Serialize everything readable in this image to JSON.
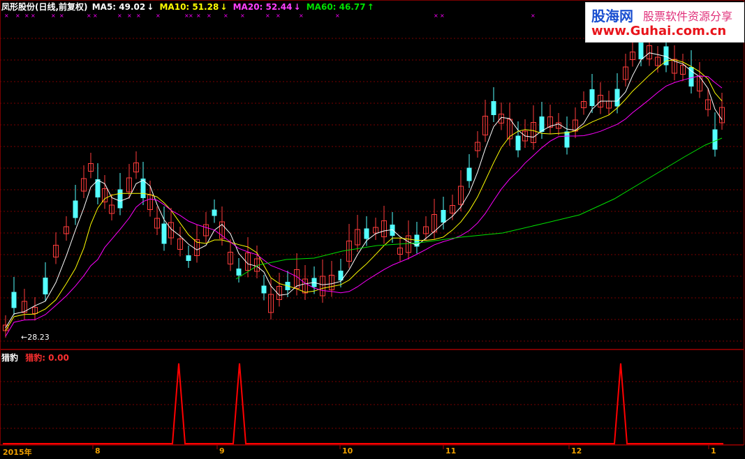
{
  "header": {
    "stock_name": "凤形股份(日线,前复权)",
    "ma5_label": "MA5: 49.02",
    "ma5_arrow": "↓",
    "ma10_label": "MA10: 51.28",
    "ma10_arrow": "↓",
    "ma20_label": "MA20: 52.44",
    "ma20_arrow": "↓",
    "ma60_label": "MA60: 46.77",
    "ma60_arrow": "↑"
  },
  "sub_panel": {
    "name": "猎豹",
    "value_label": "猎豹: 0.00"
  },
  "low_marker": "28.23",
  "watermark": {
    "brand": "股海网",
    "slogan": "股票软件资源分享",
    "url": "www.Guhai.com.cn"
  },
  "x_axis": [
    "2015年",
    "8",
    "9",
    "10",
    "11",
    "12",
    "1"
  ],
  "colors": {
    "up": "#ff3c3c",
    "down": "#54ffff",
    "ma5": "#ffffff",
    "ma10": "#ffff00",
    "ma20": "#ff00ff",
    "ma60": "#00e000",
    "grid": "#7a0000",
    "signal": "#ff0000"
  },
  "chart_data": {
    "type": "candlestick",
    "y_min_marked": 28.23,
    "ma_latest": {
      "MA5": 49.02,
      "MA10": 51.28,
      "MA20": 52.44,
      "MA60": 46.77
    },
    "signal_series": {
      "name": "猎豹",
      "latest": 0.0,
      "spike_months": [
        "8",
        "9",
        "12"
      ]
    }
  }
}
